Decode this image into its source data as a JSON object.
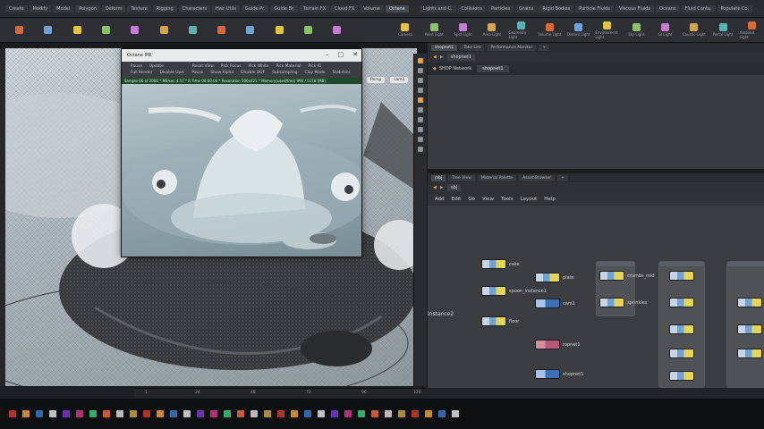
{
  "shelf": {
    "left_tabs": [
      "Create",
      "Modify",
      "Model",
      "Polygon",
      "Deform",
      "Texture",
      "Rigging",
      "Characters",
      "Hair Utils",
      "Guide Pr.",
      "Guide Br.",
      "Terrain FX",
      "Cloud FX",
      "Volume",
      "Octane"
    ],
    "right_tabs": [
      "Lights and C.",
      "Collisions",
      "Particles",
      "Grains",
      "Rigid Bodies",
      "Particle Fluids",
      "Viscous Fluids",
      "Oceans",
      "Fluid Conta.",
      "Populate Co."
    ],
    "right_tools": [
      "Camera",
      "Point Light",
      "Spot Light",
      "Area Light",
      "Geometry Light",
      "Volume Light",
      "Distant Light",
      "Environment Light",
      "Sky Light",
      "GI Light",
      "Caustic Light",
      "Portal Light",
      "Ambient Light"
    ]
  },
  "render_window": {
    "title": "Octane IPR",
    "minimize": "–",
    "maximize": "□",
    "close": "✕",
    "menu_row1": [
      "Pause",
      "Update",
      "",
      "",
      "",
      "Reset View",
      "Pick Focus",
      "Pick White",
      "Pick Material",
      "Pick Ki"
    ],
    "menu_row2": [
      "Full Render",
      "Disable Upd.",
      "Pause",
      "Show Alpha",
      "Disable DOF",
      "Subsampling",
      "Clay Mode",
      "Statistics"
    ],
    "status": "Sample 66 of 2000 * MS/sec 4.57 * R.Time 00:00:04 * Resolution 500x421 * Memory(used/free) 990 / 5118 [MB]"
  },
  "viewport": {
    "persp_label": "Persp",
    "cam_label": "cam1"
  },
  "network_top": {
    "tabs": [
      "shopnet1",
      "Take List",
      "Performance Monitor"
    ],
    "path": "shopnet1",
    "strip_label": "SHOP Network",
    "strip_value": "shopnet1"
  },
  "network_bottom": {
    "tabs": [
      "/obj",
      "Tree View",
      "Material Palette",
      "Asset Browser"
    ],
    "path": "obj",
    "menu": [
      "Add",
      "Edit",
      "Go",
      "View",
      "Tools",
      "Layout",
      "Help"
    ],
    "nodes": [
      {
        "label": "cake"
      },
      {
        "label": "plate"
      },
      {
        "label": "spoon_instance1"
      },
      {
        "label": "cam1"
      },
      {
        "label": "floor"
      },
      {
        "label": "ropnet1"
      },
      {
        "label": "shopnet1"
      },
      {
        "label": "crumbs_mid"
      },
      {
        "label": "sprinkles"
      }
    ],
    "side_label": "instance2"
  },
  "timeline": {
    "ticks": [
      "1",
      "24",
      "48",
      "72",
      "96",
      "120"
    ]
  },
  "colors": {
    "accent": "#e9a23b",
    "status_bar": "#1f4a2e",
    "node_yellow": "#e5d45a",
    "node_blue": "#3c6fb6",
    "node_red": "#b45b7a"
  }
}
